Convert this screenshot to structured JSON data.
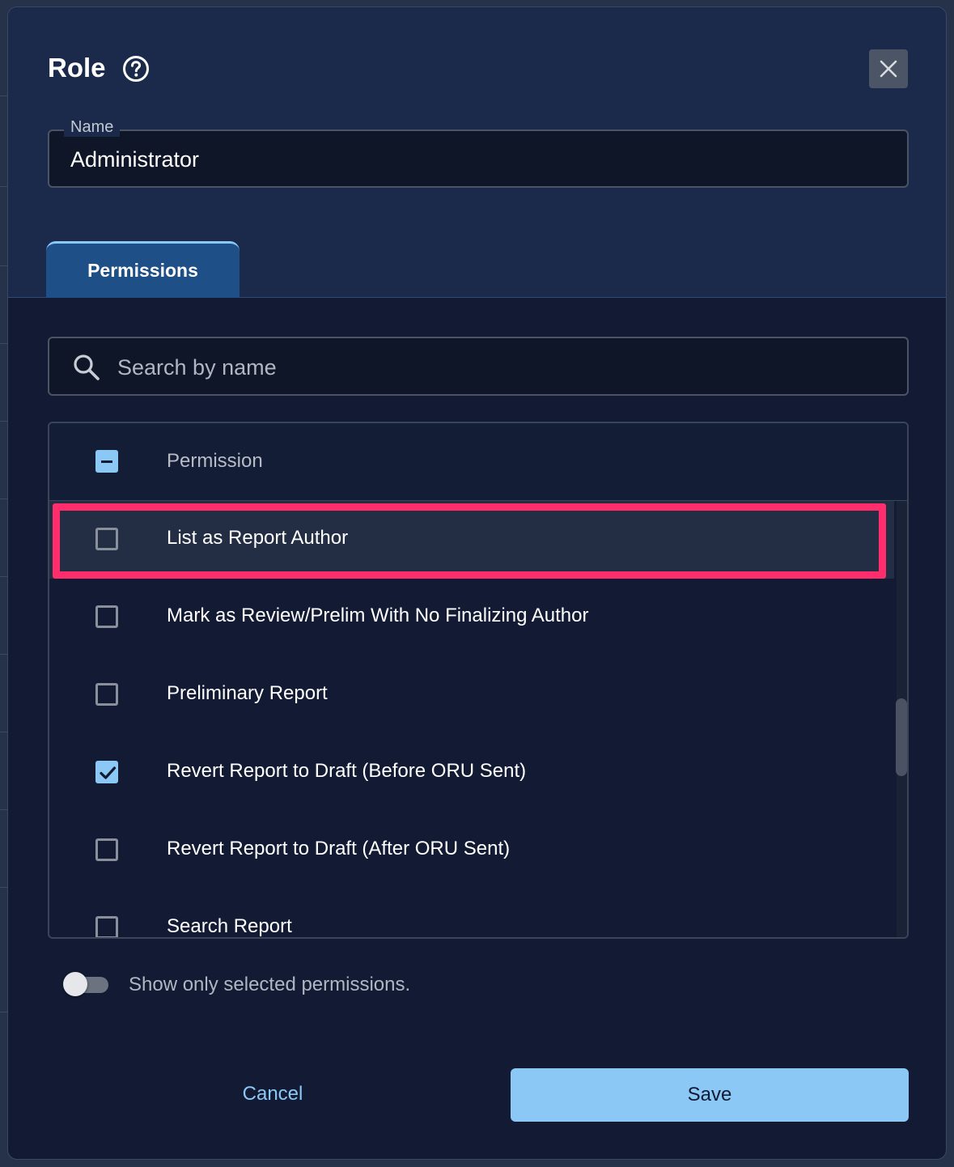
{
  "dialog": {
    "title": "Role",
    "close_icon": "close-icon",
    "help_icon": "help-circle-icon"
  },
  "name_field": {
    "label": "Name",
    "value": "Administrator"
  },
  "tabs": [
    {
      "label": "Permissions",
      "active": true
    }
  ],
  "search": {
    "placeholder": "Search by name",
    "icon": "search-icon"
  },
  "table": {
    "header_label": "Permission",
    "select_all_state": "indeterminate",
    "rows": [
      {
        "label": "List as Report Author",
        "checked": false,
        "highlighted": true
      },
      {
        "label": "Mark as Review/Prelim With No Finalizing Author",
        "checked": false
      },
      {
        "label": "Preliminary Report",
        "checked": false
      },
      {
        "label": "Revert Report to Draft (Before ORU Sent)",
        "checked": true
      },
      {
        "label": "Revert Report to Draft (After ORU Sent)",
        "checked": false
      },
      {
        "label": "Search Report",
        "checked": false
      }
    ]
  },
  "filter_toggle": {
    "label": "Show only selected permissions.",
    "on": false
  },
  "actions": {
    "cancel_label": "Cancel",
    "save_label": "Save"
  },
  "colors": {
    "accent": "#8cc8f6",
    "highlight_box": "#ff2d6c",
    "dialog_bg": "#121b33"
  }
}
